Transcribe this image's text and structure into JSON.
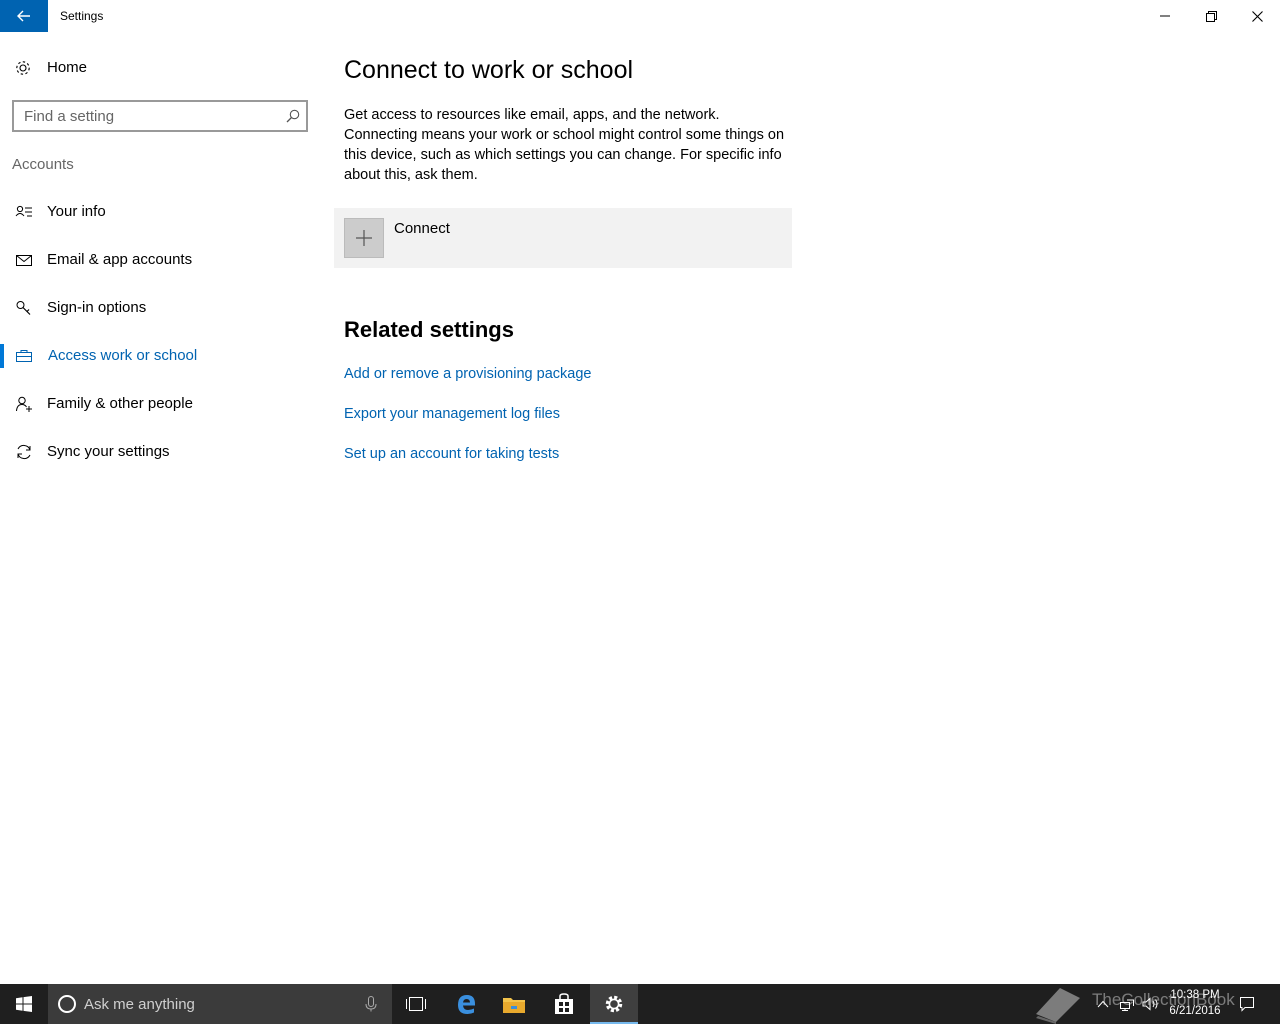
{
  "window": {
    "title": "Settings"
  },
  "sidebar": {
    "home_label": "Home",
    "search_placeholder": "Find a setting",
    "section_title": "Accounts",
    "items": [
      {
        "label": "Your info",
        "icon": "person-card-icon"
      },
      {
        "label": "Email & app accounts",
        "icon": "mail-icon"
      },
      {
        "label": "Sign-in options",
        "icon": "key-icon"
      },
      {
        "label": "Access work or school",
        "icon": "briefcase-icon",
        "selected": true
      },
      {
        "label": "Family & other people",
        "icon": "add-person-icon"
      },
      {
        "label": "Sync your settings",
        "icon": "sync-icon"
      }
    ]
  },
  "main": {
    "title": "Connect to work or school",
    "description": "Get access to resources like email, apps, and the network. Connecting means your work or school might control some things on this device, such as which settings you can change. For specific info about this, ask them.",
    "connect_label": "Connect",
    "related_title": "Related settings",
    "links": [
      "Add or remove a provisioning package",
      "Export your management log files",
      "Set up an account for taking tests"
    ]
  },
  "taskbar": {
    "search_placeholder": "Ask me anything",
    "time": "10:38 PM",
    "date": "6/21/2016",
    "watermark": "TheCollectionBook"
  },
  "colors": {
    "accent": "#0063b1",
    "selection_bar": "#0078d7",
    "taskbar": "#1f1f1f",
    "cortana_box": "#3b3b3b"
  }
}
